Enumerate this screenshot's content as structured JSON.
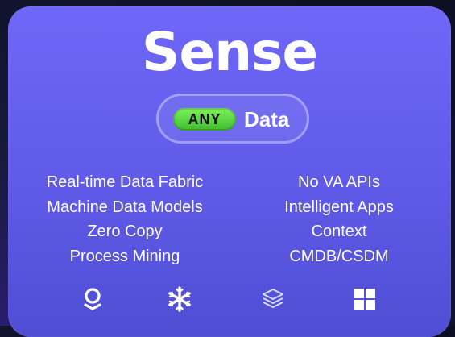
{
  "card": {
    "title": "Sense",
    "badge": {
      "any_label": "ANY",
      "data_label": "Data"
    },
    "features_left": [
      "Real-time Data Fabric",
      "Machine Data Models",
      "Zero Copy",
      "Process Mining"
    ],
    "features_right": [
      "No VA APIs",
      "Intelligent Apps",
      "Context",
      "CMDB/CSDM"
    ],
    "icons": [
      "palantir-icon",
      "snowflake-icon",
      "layers-icon",
      "microsoft-windows-icon"
    ]
  },
  "colors": {
    "card_top": "#6f67f7",
    "card_bottom": "#4f4ed3",
    "badge_green": "#5ad43f",
    "text": "#ffffff"
  }
}
